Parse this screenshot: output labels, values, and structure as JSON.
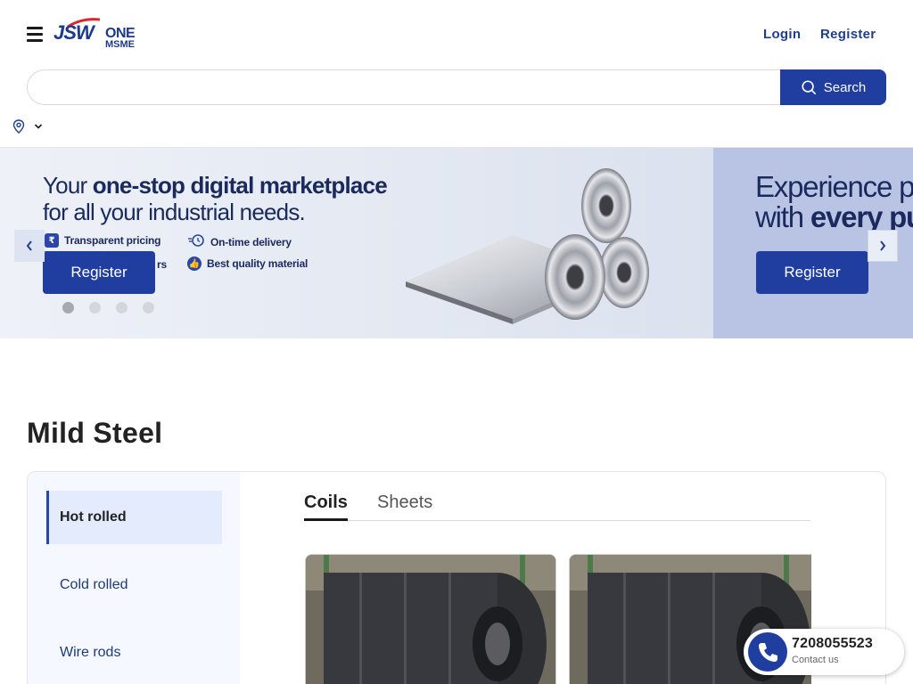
{
  "header": {
    "brand_jsw": "JSW",
    "brand_one": "ONE",
    "brand_msme": "MSME",
    "login_label": "Login",
    "register_label": "Register"
  },
  "search": {
    "value": "",
    "placeholder": "",
    "button_label": "Search"
  },
  "banner": {
    "slide1": {
      "headline_pre": "Your ",
      "headline_bold": "one-stop digital marketplace",
      "headline_line2": "for all your industrial needs.",
      "features": [
        "Transparent pricing",
        "On-time delivery",
        "rs",
        "Best quality material"
      ],
      "register_label": "Register"
    },
    "slide2": {
      "headline_line1": "Experience p",
      "headline_line2_pre": "with ",
      "headline_line2_bold": "every pu",
      "register_label": "Register"
    },
    "dots": 4,
    "active_dot": 0
  },
  "section": {
    "title": "Mild Steel",
    "categories": [
      "Hot rolled",
      "Cold rolled",
      "Wire rods"
    ],
    "active_category": 0,
    "tabs": [
      "Coils",
      "Sheets"
    ],
    "active_tab": 0
  },
  "contact": {
    "phone": "7208055523",
    "label": "Contact us"
  },
  "colors": {
    "brand_blue": "#1f3e9f",
    "nav_blue": "#1f3e8c",
    "banner_bg": "#e3e8f2"
  }
}
